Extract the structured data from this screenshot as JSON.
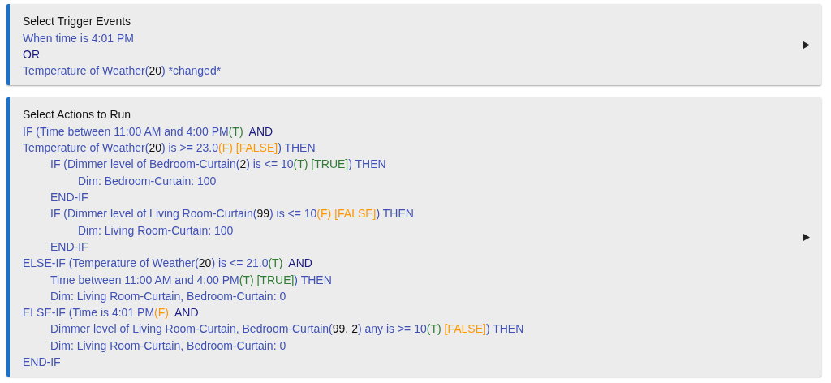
{
  "cards": [
    {
      "title": "Select Trigger Events",
      "lines": [
        {
          "segments": [
            {
              "kind": "text",
              "text": "When time is 4:01 PM"
            }
          ]
        },
        {
          "segments": [
            {
              "kind": "op",
              "text": "OR"
            }
          ]
        },
        {
          "segments": [
            {
              "kind": "text",
              "text": "Temperature of Weather("
            },
            {
              "kind": "num",
              "text": "20"
            },
            {
              "kind": "text",
              "text": ") *changed*"
            }
          ]
        }
      ]
    },
    {
      "title": "Select Actions to Run",
      "lines": [
        {
          "segments": [
            {
              "kind": "text",
              "text": "IF (Time between 11:00 AM and 4:00 PM"
            },
            {
              "kind": "true",
              "text": "(T)"
            },
            {
              "kind": "op",
              "text": "  AND"
            }
          ]
        },
        {
          "segments": [
            {
              "kind": "text",
              "text": "Temperature of Weather("
            },
            {
              "kind": "num",
              "text": "20"
            },
            {
              "kind": "text",
              "text": ") is >= 23.0"
            },
            {
              "kind": "false",
              "text": "(F) [FALSE]"
            },
            {
              "kind": "text",
              "text": ") THEN"
            }
          ],
          "children": [
            {
              "segments": [
                {
                  "kind": "text",
                  "text": "IF (Dimmer level of Bedroom-Curtain("
                },
                {
                  "kind": "num",
                  "text": "2"
                },
                {
                  "kind": "text",
                  "text": ") is <= 10"
                },
                {
                  "kind": "true",
                  "text": "(T) [TRUE]"
                },
                {
                  "kind": "text",
                  "text": ") THEN"
                }
              ],
              "children": [
                {
                  "segments": [
                    {
                      "kind": "text",
                      "text": "Dim: Bedroom-Curtain: 100"
                    }
                  ]
                }
              ]
            },
            {
              "segments": [
                {
                  "kind": "text",
                  "text": "END-IF"
                }
              ]
            },
            {
              "segments": [
                {
                  "kind": "text",
                  "text": "IF (Dimmer level of Living Room-Curtain("
                },
                {
                  "kind": "num",
                  "text": "99"
                },
                {
                  "kind": "text",
                  "text": ") is <= 10"
                },
                {
                  "kind": "false",
                  "text": "(F) [FALSE]"
                },
                {
                  "kind": "text",
                  "text": ") THEN"
                }
              ],
              "children": [
                {
                  "segments": [
                    {
                      "kind": "text",
                      "text": "Dim: Living Room-Curtain: 100"
                    }
                  ]
                }
              ]
            },
            {
              "segments": [
                {
                  "kind": "text",
                  "text": "END-IF"
                }
              ]
            }
          ]
        },
        {
          "segments": [
            {
              "kind": "text",
              "text": "ELSE-IF (Temperature of Weather("
            },
            {
              "kind": "num",
              "text": "20"
            },
            {
              "kind": "text",
              "text": ") is <= 21.0"
            },
            {
              "kind": "true",
              "text": "(T)"
            },
            {
              "kind": "op",
              "text": "  AND"
            }
          ],
          "children": [
            {
              "segments": [
                {
                  "kind": "text",
                  "text": "Time between 11:00 AM and 4:00 PM"
                },
                {
                  "kind": "true",
                  "text": "(T) [TRUE]"
                },
                {
                  "kind": "text",
                  "text": ") THEN"
                }
              ]
            },
            {
              "segments": [
                {
                  "kind": "text",
                  "text": "Dim: Living Room-Curtain, Bedroom-Curtain: 0"
                }
              ]
            }
          ]
        },
        {
          "segments": [
            {
              "kind": "text",
              "text": "ELSE-IF (Time is 4:01 PM"
            },
            {
              "kind": "false",
              "text": "(F)"
            },
            {
              "kind": "op",
              "text": "  AND"
            }
          ],
          "children": [
            {
              "segments": [
                {
                  "kind": "text",
                  "text": "Dimmer level of Living Room-Curtain, Bedroom-Curtain("
                },
                {
                  "kind": "num",
                  "text": "99, 2"
                },
                {
                  "kind": "text",
                  "text": ") any is >= 10"
                },
                {
                  "kind": "true",
                  "text": "(T)"
                },
                {
                  "kind": "false",
                  "text": " [FALSE]"
                },
                {
                  "kind": "text",
                  "text": ") THEN"
                }
              ]
            },
            {
              "segments": [
                {
                  "kind": "text",
                  "text": "Dim: Living Room-Curtain, Bedroom-Curtain: 0"
                }
              ]
            }
          ]
        },
        {
          "segments": [
            {
              "kind": "text",
              "text": "END-IF"
            }
          ]
        }
      ]
    }
  ]
}
